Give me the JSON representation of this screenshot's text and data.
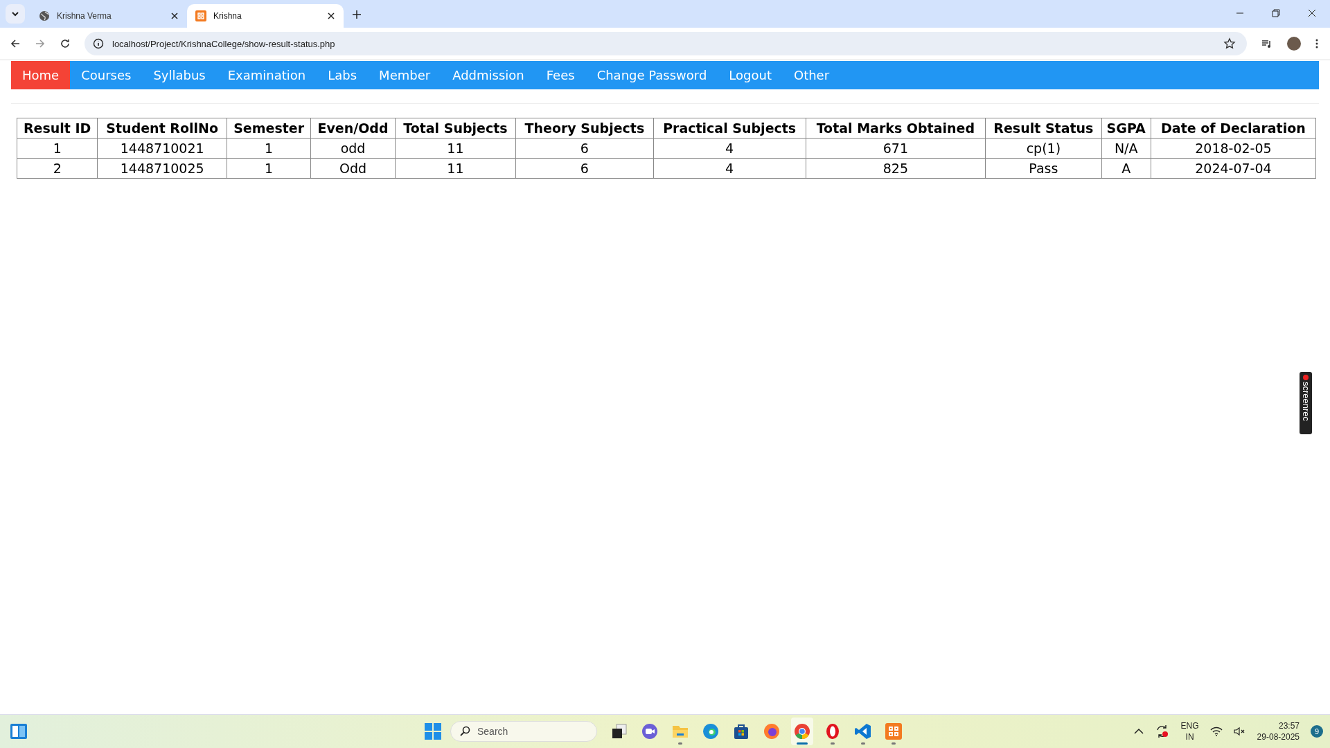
{
  "browser": {
    "tabs": [
      {
        "title": "Krishna Verma",
        "kind": "globe",
        "selected": false
      },
      {
        "title": "Krishna",
        "kind": "xampp",
        "selected": true
      }
    ],
    "address": "localhost/Project/KrishnaCollege/show-result-status.php"
  },
  "nav": [
    {
      "label": "Home",
      "selected": true
    },
    {
      "label": "Courses",
      "selected": false
    },
    {
      "label": "Syllabus",
      "selected": false
    },
    {
      "label": "Examination",
      "selected": false
    },
    {
      "label": "Labs",
      "selected": false
    },
    {
      "label": "Member",
      "selected": false
    },
    {
      "label": "Addmission",
      "selected": false
    },
    {
      "label": "Fees",
      "selected": false
    },
    {
      "label": "Change Password",
      "selected": false
    },
    {
      "label": "Logout",
      "selected": false
    },
    {
      "label": "Other",
      "selected": false
    }
  ],
  "table": {
    "columns": [
      "Result ID",
      "Student RollNo",
      "Semester",
      "Even/Odd",
      "Total Subjects",
      "Theory Subjects",
      "Practical Subjects",
      "Total Marks Obtained",
      "Result Status",
      "SGPA",
      "Date of Declaration"
    ],
    "rows": [
      [
        "1",
        "1448710021",
        "1",
        "odd",
        "11",
        "6",
        "4",
        "671",
        "cp(1)",
        "N/A",
        "2018-02-05"
      ],
      [
        "2",
        "1448710025",
        "1",
        "Odd",
        "11",
        "6",
        "4",
        "825",
        "Pass",
        "A",
        "2024-07-04"
      ]
    ]
  },
  "recorder_tab": "screenrec",
  "taskbar": {
    "search_placeholder": "Search",
    "apps": [
      {
        "kind": "taskview",
        "running": false,
        "selected": false
      },
      {
        "kind": "meet",
        "running": false,
        "selected": false
      },
      {
        "kind": "folder",
        "running": true,
        "selected": false
      },
      {
        "kind": "edge",
        "running": false,
        "selected": false
      },
      {
        "kind": "store",
        "running": false,
        "selected": false
      },
      {
        "kind": "firefox",
        "running": false,
        "selected": false
      },
      {
        "kind": "chrome",
        "running": true,
        "selected": true
      },
      {
        "kind": "opera",
        "running": true,
        "selected": false
      },
      {
        "kind": "vscode",
        "running": true,
        "selected": false
      },
      {
        "kind": "xampp",
        "running": true,
        "selected": false
      }
    ],
    "language": "ENG",
    "region": "IN",
    "time": "23:57",
    "date": "29-08-2025",
    "notifications": "9"
  }
}
